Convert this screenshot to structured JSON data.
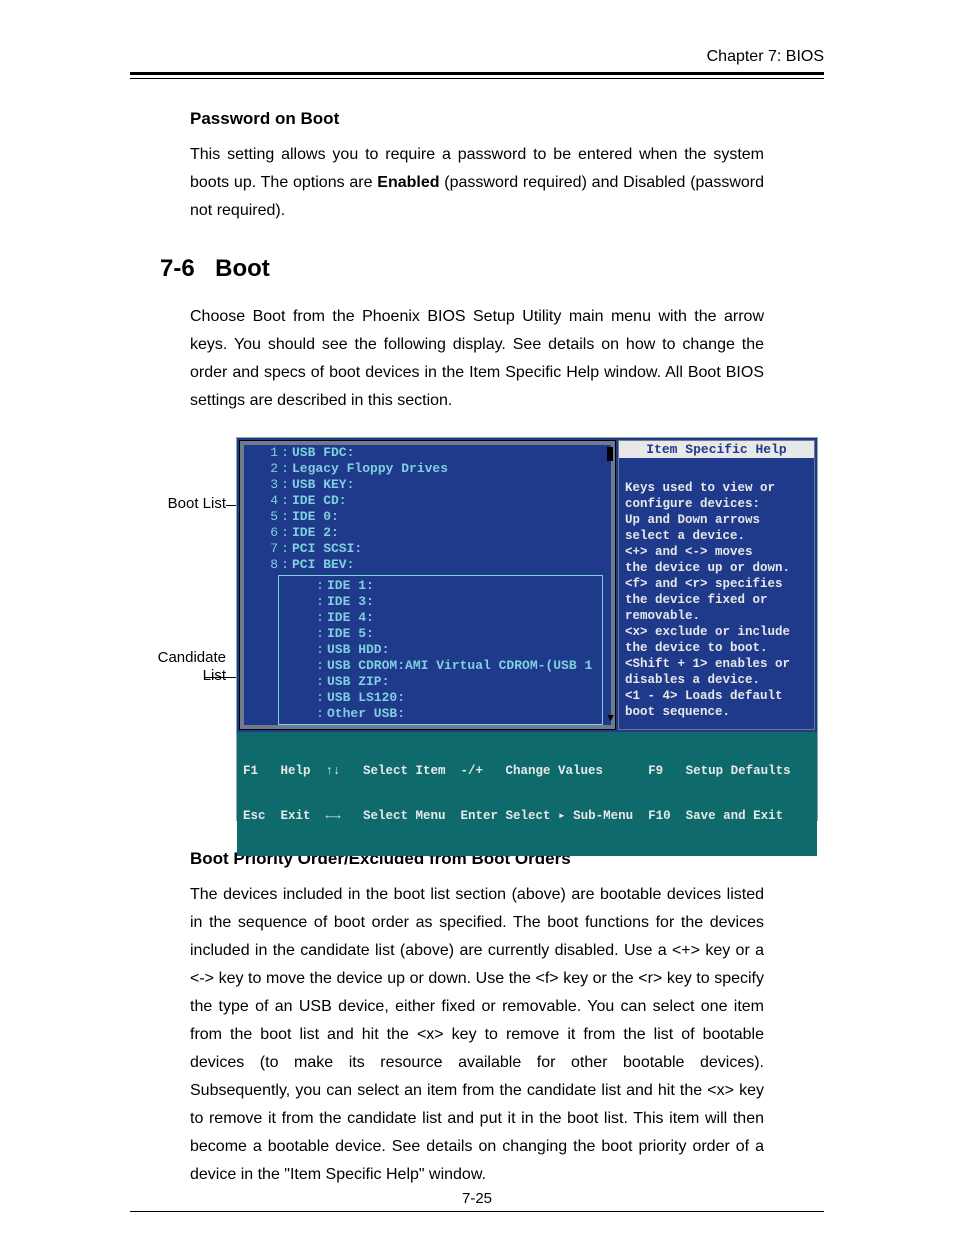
{
  "chapter_header": "Chapter 7: BIOS",
  "password_on_boot": {
    "heading": "Password on Boot",
    "para_before": "This setting allows you to require a password to be entered when the system boots up.  The options are ",
    "bold_word": "Enabled",
    "para_after": " (password required) and Disabled (password not required)."
  },
  "section": {
    "number": "7-6",
    "title": "Boot",
    "intro": "Choose Boot from the Phoenix BIOS Setup Utility main menu with the arrow keys. You should see the following display.  See details on how to change the order and specs of boot devices in the Item Specific Help window.  All Boot BIOS settings are described in this section."
  },
  "callouts": {
    "boot_list": "Boot List",
    "candidate_list_1": "Candidate",
    "candidate_list_2": "List"
  },
  "bios": {
    "help_title": "Item Specific Help",
    "boot_list": [
      {
        "n": "1",
        "d": "USB FDC:"
      },
      {
        "n": "2",
        "d": "Legacy Floppy Drives"
      },
      {
        "n": "3",
        "d": "USB KEY:"
      },
      {
        "n": "4",
        "d": "IDE CD:"
      },
      {
        "n": "5",
        "d": "IDE 0:"
      },
      {
        "n": "6",
        "d": "IDE 2:"
      },
      {
        "n": "7",
        "d": "PCI SCSI:"
      },
      {
        "n": "8",
        "d": "PCI BEV:"
      }
    ],
    "candidate_list": [
      "IDE 1:",
      "IDE 3:",
      "IDE 4:",
      "IDE 5:",
      "USB HDD:",
      "USB CDROM:AMI Virtual CDROM-(USB 1",
      "USB ZIP:",
      "USB LS120:",
      "Other USB:"
    ],
    "help_lines": [
      "Keys used to view or",
      "configure devices:",
      "Up and Down arrows",
      "select a device.",
      "<+> and <-> moves",
      "the device up or down.",
      "<f> and <r> specifies",
      "the device fixed or",
      "removable.",
      "<x> exclude or include",
      "the device to boot.",
      "<Shift + 1> enables or",
      "disables a device.",
      "<1 - 4> Loads default",
      "boot sequence."
    ],
    "footer_line1": "F1   Help  ↑↓   Select Item  -/+   Change Values      F9   Setup Defaults",
    "footer_line2": "Esc  Exit  ←→   Select Menu  Enter Select ▸ Sub-Menu  F10  Save and Exit"
  },
  "priority": {
    "heading": "Boot Priority Order/Excluded from Boot Orders",
    "para": "The devices included in the boot list section (above) are bootable devices listed in the sequence of boot order as specified. The boot functions for the devices included in the candidate list (above) are currently disabled.  Use a <+> key or a <-> key to move the device up or down. Use the <f> key or the <r> key to specify the type of an USB device, either fixed or removable. You can select one item from the boot list and hit the <x> key to remove it from the list of bootable devices (to make its resource available for other bootable devices). Subsequently, you can select an item from the candidate list and hit the <x> key  to remove it from the candidate list and put it in the boot list. This item will then become a bootable device. See details on changing the boot priority order of a device in the \"Item Specific Help\" window."
  },
  "page_number": "7-25"
}
